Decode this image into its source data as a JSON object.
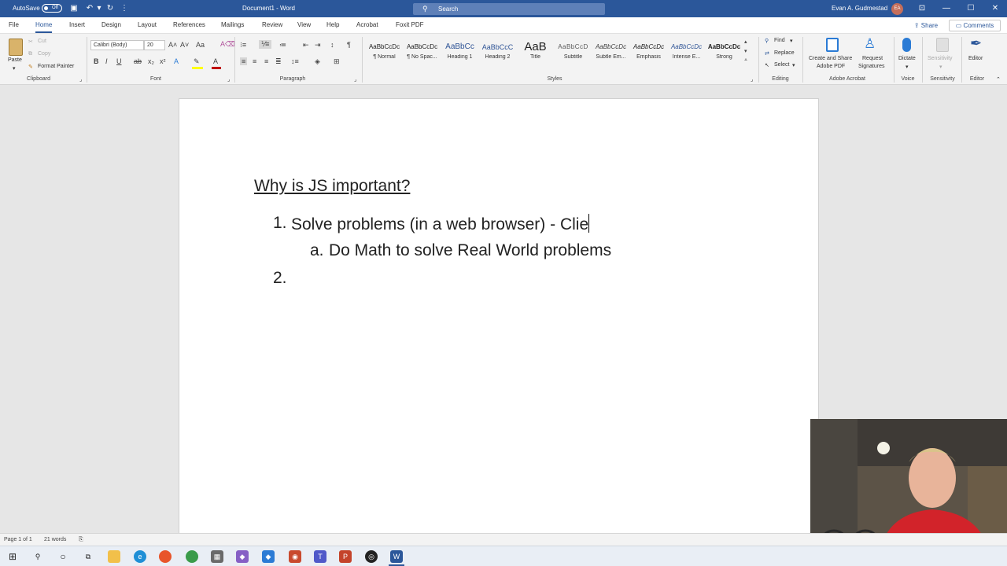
{
  "titlebar": {
    "autosave_label": "AutoSave",
    "autosave_state": "Off",
    "document_title": "Document1 - Word",
    "search_placeholder": "Search",
    "user_name": "Evan A. Gudmestad",
    "user_initials": "EA",
    "minimize": "—",
    "maximize": "☐",
    "close": "✕",
    "ribbon_display": "⊡"
  },
  "tabs": [
    "File",
    "Home",
    "Insert",
    "Design",
    "Layout",
    "References",
    "Mailings",
    "Review",
    "View",
    "Help",
    "Acrobat",
    "Foxit PDF"
  ],
  "active_tab": "Home",
  "share_label": "Share",
  "comments_label": "Comments",
  "ribbon": {
    "clipboard": {
      "label": "Clipboard",
      "paste": "Paste",
      "cut": "Cut",
      "copy": "Copy",
      "format_painter": "Format Painter"
    },
    "font": {
      "label": "Font",
      "font_name": "Calibri (Body)",
      "font_size": "20",
      "bold": "B",
      "italic": "I",
      "underline": "U"
    },
    "paragraph": {
      "label": "Paragraph"
    },
    "styles": {
      "label": "Styles",
      "items": [
        {
          "preview": "AaBbCcDc",
          "name": "¶ Normal"
        },
        {
          "preview": "AaBbCcDc",
          "name": "¶ No Spac..."
        },
        {
          "preview": "AaBbCc",
          "name": "Heading 1"
        },
        {
          "preview": "AaBbCcC",
          "name": "Heading 2"
        },
        {
          "preview": "AaB",
          "name": "Title"
        },
        {
          "preview": "AaBbCcD",
          "name": "Subtitle"
        },
        {
          "preview": "AaBbCcDc",
          "name": "Subtle Em..."
        },
        {
          "preview": "AaBbCcDc",
          "name": "Emphasis"
        },
        {
          "preview": "AaBbCcDc",
          "name": "Intense E..."
        },
        {
          "preview": "AaBbCcDc",
          "name": "Strong"
        }
      ]
    },
    "editing": {
      "label": "Editing",
      "find": "Find",
      "replace": "Replace",
      "select": "Select"
    },
    "acrobat": {
      "label": "Adobe Acrobat",
      "create_share_line1": "Create and Share",
      "create_share_line2": "Adobe PDF",
      "request_line1": "Request",
      "request_line2": "Signatures"
    },
    "voice": {
      "label": "Voice",
      "dictate": "Dictate"
    },
    "sensitivity": {
      "label": "Sensitivity",
      "button": "Sensitivity"
    },
    "editor": {
      "label": "Editor",
      "button": "Editor"
    }
  },
  "document": {
    "heading": "Why is JS important?",
    "items": [
      {
        "num": "1.",
        "text": "Solve problems (in a web browser) - Clie"
      },
      {
        "num": "a.",
        "text": "Do Math to solve Real World problems"
      },
      {
        "num": "2.",
        "text": ""
      }
    ]
  },
  "statusbar": {
    "page": "Page 1 of 1",
    "words": "21 words"
  },
  "colors": {
    "word_blue": "#2b579a",
    "font_highlight": "#ffff00",
    "font_color": "#c00000"
  }
}
